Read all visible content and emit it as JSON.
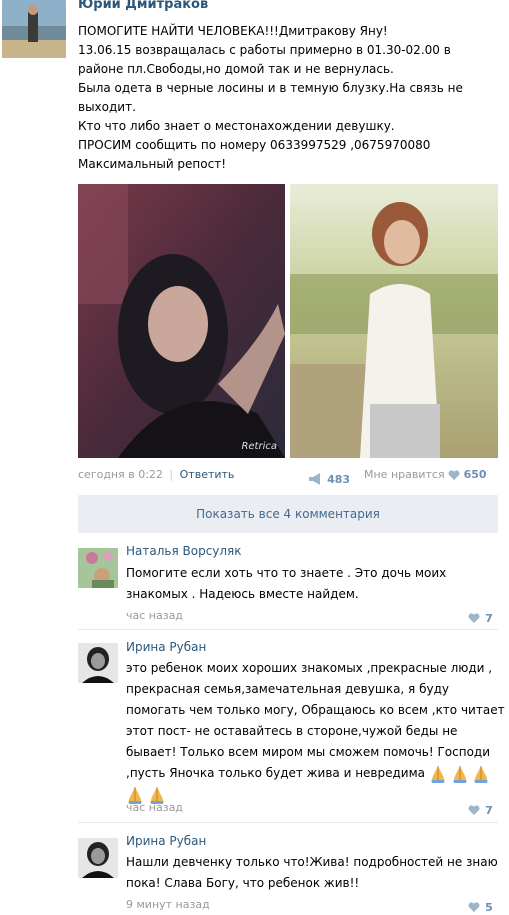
{
  "post": {
    "author": "Юрий Дмитраков",
    "lines": [
      "ПОМОГИТЕ НАЙТИ ЧЕЛОВЕКА!!!Дмитракову Яну!",
      "13.06.15 возвращалась с работы примерно в 01.30-02.00 в",
      "районе пл.Свободы,но домой так и не вернулась.",
      "Была одета в черные лосины и в темную блузку.На связь не",
      "выходит.",
      "Кто что либо знает о местонахождении девушку.",
      "ПРОСИМ сообщить по номеру 0633997529 ,0675970080",
      "Максимальный репост!"
    ],
    "photo_watermark": "Retrica",
    "time": "сегодня в 0:22",
    "separator": "|",
    "reply_label": "Ответить",
    "reposts": "483",
    "like_label": "Мне нравится",
    "likes": "650",
    "icons": {
      "repost": "megaphone-icon",
      "like": "heart-icon"
    }
  },
  "show_all_comments": "Показать все 4 комментария",
  "comments": [
    {
      "author": "Наталья Ворсуляк",
      "lines": [
        "Помогите если хоть что то знаете . Это дочь моих",
        "знакомых . Надеюсь вместе найдем."
      ],
      "time": "час назад",
      "likes": "7"
    },
    {
      "author": "Ирина Рубан",
      "lines": [
        "это ребенок моих хороших знакомых ,прекрасные люди ,",
        "прекрасная семья,замечательная девушка, я буду",
        "помогать чем только могу, Обращаюсь ко всем ,кто читает",
        "этот пост- не оставайтесь в стороне,чужой беды не",
        "бывает! Только всем миром мы сможем помочь! Господи",
        ",пусть Яночка только будет жива и невредима"
      ],
      "emoji": "praying-hands-icon",
      "time": "час назад",
      "likes": "7"
    },
    {
      "author": "Ирина Рубан",
      "lines": [
        "Нашли девченку только что!Жива! подробностей не знаю",
        "пока! Слава Богу, что ребенок жив!!"
      ],
      "time": "9 минут назад",
      "likes": "5"
    }
  ],
  "colors": {
    "link": "#2b587a",
    "button_bg": "#eaeef2",
    "muted": "#999999",
    "like": "#6d8fb3"
  }
}
